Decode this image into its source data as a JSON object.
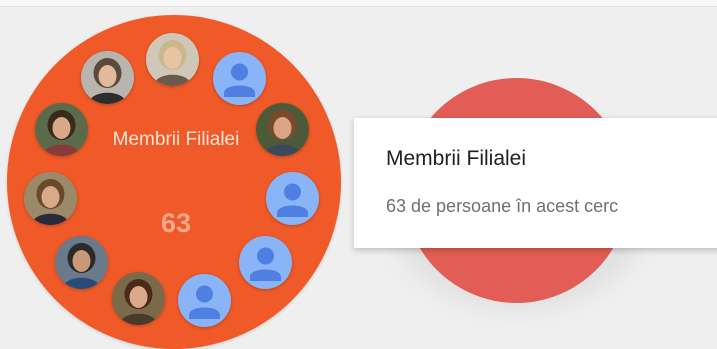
{
  "circle": {
    "name": "Membrii Filialei",
    "count": "63",
    "color": "#f05a28"
  },
  "tooltip": {
    "title": "Membrii Filialei",
    "subtitle": "63 de persoane în acest cerc"
  },
  "members": [
    {
      "type": "photo",
      "icon": "member-photo"
    },
    {
      "type": "photo",
      "icon": "member-photo"
    },
    {
      "type": "placeholder",
      "icon": "default-avatar-icon"
    },
    {
      "type": "photo",
      "icon": "member-photo"
    },
    {
      "type": "photo",
      "icon": "member-photo"
    },
    {
      "type": "placeholder",
      "icon": "default-avatar-icon"
    },
    {
      "type": "photo",
      "icon": "member-photo"
    },
    {
      "type": "placeholder",
      "icon": "default-avatar-icon"
    },
    {
      "type": "photo",
      "icon": "member-photo"
    },
    {
      "type": "photo",
      "icon": "member-photo"
    },
    {
      "type": "placeholder",
      "icon": "default-avatar-icon"
    }
  ],
  "colors": {
    "secondary_circle": "#e25d55",
    "avatar_placeholder_bg": "#8ab4f8",
    "avatar_placeholder_icon": "#4f7fe0"
  }
}
